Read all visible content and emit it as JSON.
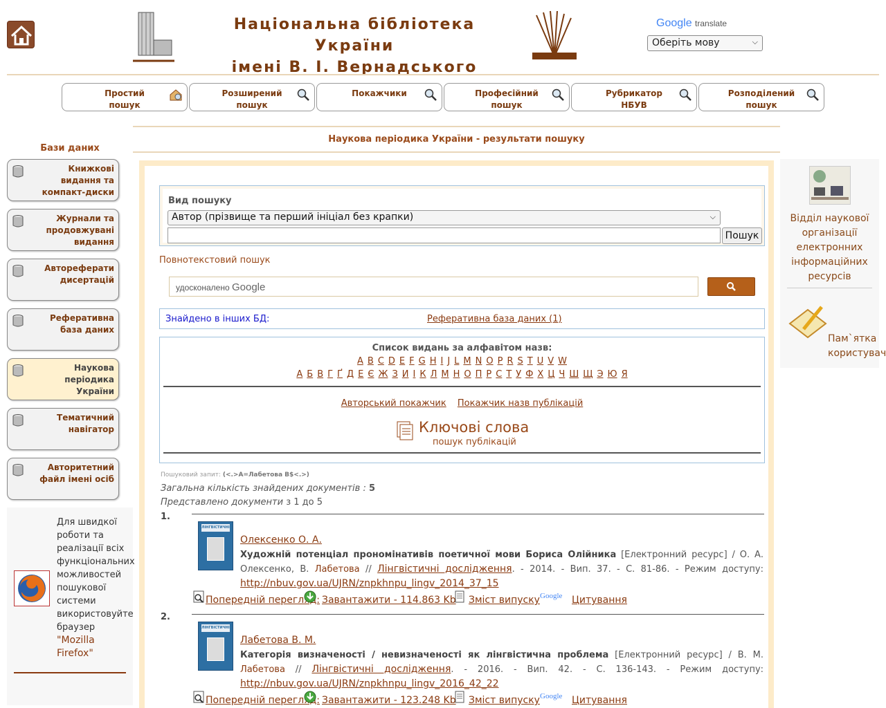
{
  "header": {
    "title_line1": "Національна бібліотека України",
    "title_line2": "імені В. І. Вернадського",
    "translate_brand": "Google",
    "translate_word": "translate",
    "lang_select": "Оберіть мову"
  },
  "nav": [
    {
      "l1": "Простий",
      "l2": "пошук"
    },
    {
      "l1": "Розширений",
      "l2": "пошук"
    },
    {
      "l1": "Покажчики",
      "l2": ""
    },
    {
      "l1": "Професійний",
      "l2": "пошук"
    },
    {
      "l1": "Рубрикатор",
      "l2": "НБУВ"
    },
    {
      "l1": "Розподілений",
      "l2": "пошук"
    }
  ],
  "section_title": "Наукова періодика України - результати пошуку",
  "sidebar": {
    "heading": "Бази даних",
    "items": [
      "Книжкові видання та компакт-диски",
      "Журнали та продовжувані видання",
      "Автореферати дисертацій",
      "Реферативна база даних",
      "Наукова періодика України",
      "Тематичний навігатор",
      "Авторитетний файл імені осіб"
    ],
    "firefox_text": "Для швидкої роботи та реалізації всіх функціональних можливостей пошукової системи використовуйте браузер",
    "firefox_link": "\"Mozilla Firefox\""
  },
  "right": {
    "dept": "Відділ наукової організації електронних інформаційних ресурсів",
    "memo": "Пам`ятка користувача"
  },
  "search": {
    "type_label": "Вид пошуку",
    "type_value": "Автор (прізвище та перший ініціал без крапки)",
    "query_value": "",
    "button": "Пошук",
    "fulltext_label": "Повнотекстовий пошук",
    "gcse_prefix": "удосконалено",
    "gcse_brand": "Google"
  },
  "found_other": {
    "label": "Знайдено в інших БД:",
    "link": "Реферативна база даних (1)"
  },
  "alphabet": {
    "title": "Список видань за алфавітом назв:",
    "latin": [
      "A",
      "B",
      "C",
      "D",
      "E",
      "F",
      "G",
      "H",
      "I",
      "J",
      "L",
      "M",
      "N",
      "O",
      "P",
      "R",
      "S",
      "T",
      "U",
      "V",
      "W"
    ],
    "cyrillic": [
      "А",
      "Б",
      "В",
      "Г",
      "Ґ",
      "Д",
      "Е",
      "Є",
      "Ж",
      "З",
      "И",
      "І",
      "К",
      "Л",
      "М",
      "Н",
      "О",
      "П",
      "Р",
      "С",
      "Т",
      "У",
      "Ф",
      "Х",
      "Ц",
      "Ч",
      "Ш",
      "Щ",
      "Э",
      "Ю",
      "Я"
    ],
    "link1": "Авторський покажчик",
    "link2": "Покажчик назв публікацій",
    "keywords_big": "Ключові слова",
    "keywords_small": "пошук публікацій"
  },
  "results_meta": {
    "query_label": "Пошуковий запит:",
    "query": "(<.>A=Лабетова В$<.>)",
    "total_label": "Загальна кількість знайдених документів",
    "total": "5",
    "shown_label": "Представлено документи",
    "shown_range": "з 1 до 5"
  },
  "results": [
    {
      "num": "1.",
      "cover_text": "ЛІНГВІСТИЧНІ ДОСЛІДЖЕННЯ",
      "author": "Олексенко О. А.",
      "title": "Художній потенціал прономінативів поетичної мови Бориса Олійника",
      "resp_before": "[Електронний ресурс] / О. А. Олексенко, В.",
      "resp_hl": "Лабетова",
      "sep": "//",
      "journal": "Лінгвістичні дослідження",
      "details": ". - 2014. - Вип. 37. - С. 81-86. - Режим доступу:",
      "url": "http://nbuv.gov.ua/UJRN/znpkhnpu_lingv_2014_37_15",
      "preview": "Попередній перегляд:",
      "download": "Завантажити - 114.863 Kb",
      "contents": "Зміст випуску",
      "cite": "Цитування"
    },
    {
      "num": "2.",
      "cover_text": "ЛІНГВІСТИЧНІ ДОСЛІДЖЕННЯ",
      "author": "Лабетова В. М.",
      "title": "Категорія визначеності / невизначеності як лінгвістична проблема",
      "resp_before": "[Електронний ресурс] / В. М.",
      "resp_hl": "Лабетова",
      "sep": "//",
      "journal": "Лінгвістичні дослідження",
      "details": ". - 2016. - Вип. 42. - С. 136-143. - Режим доступу:",
      "url": "http://nbuv.gov.ua/UJRN/znpkhnpu_lingv_2016_42_22",
      "preview": "Попередній перегляд:",
      "download": "Завантажити - 123.248 Kb",
      "contents": "Зміст випуску",
      "cite": "Цитування"
    }
  ]
}
